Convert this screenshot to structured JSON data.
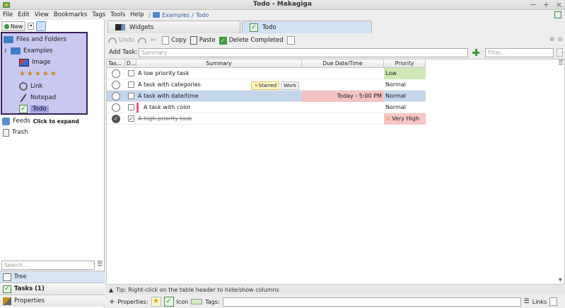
{
  "window": {
    "title": "Todo - Makagiga",
    "controls": [
      "−",
      "+",
      "×"
    ]
  },
  "menu": {
    "items": [
      "File",
      "Edit",
      "View",
      "Bookmarks",
      "Tags",
      "Tools",
      "Help"
    ],
    "breadcrumb": {
      "sep": "/",
      "items": [
        "Examples",
        "Todo"
      ]
    }
  },
  "left": {
    "new_label": "New",
    "tree": {
      "root": "Files and Folders",
      "folder": "Examples",
      "items": [
        "Image",
        "Link",
        "Notepad",
        "Todo"
      ],
      "rating_stars": "★★★★★",
      "expander": "↕"
    },
    "feeds": {
      "label": "Feeds",
      "hint": "Click to expand"
    },
    "trash": "Trash",
    "search_placeholder": "Search...",
    "accordion": [
      "Tree",
      "Tasks (1)",
      "Properties"
    ]
  },
  "tabs": [
    "Widgets",
    "Todo"
  ],
  "toolbar": {
    "undo": "Undo",
    "copy": "Copy",
    "paste": "Paste",
    "delete_completed": "Delete Completed"
  },
  "add_task": {
    "label": "Add Task:",
    "placeholder": "Summary",
    "filter_placeholder": "Filter..."
  },
  "table": {
    "headers": [
      "Tas...",
      "D...",
      "Summary",
      "Due Date/Time",
      "Priority"
    ],
    "rows": [
      {
        "summary": "A low priority task",
        "tags": [],
        "due": "",
        "priority": "Low",
        "done": false,
        "checked": false
      },
      {
        "summary": "A task with categories",
        "tags": [
          "Starred",
          "Work"
        ],
        "due": "",
        "priority": "Normal",
        "done": false,
        "checked": false
      },
      {
        "summary": "A task with date/time",
        "tags": [],
        "due": "Today - 5:00 PM",
        "priority": "Normal",
        "done": false,
        "checked": false
      },
      {
        "summary": "A task with color",
        "tags": [],
        "due": "",
        "priority": "Normal",
        "done": false,
        "checked": false
      },
      {
        "summary": "A high priority task",
        "tags": [],
        "due": "",
        "priority": "Very High",
        "done": true,
        "checked": true
      }
    ]
  },
  "tip": "Tip: Right-click on the table header to hide/show columns",
  "properties_bar": {
    "label": "Properties:",
    "icon_label": "Icon",
    "tags_label": "Tags:",
    "links_label": "Links"
  },
  "colors": {
    "selection": "#c5d6ec",
    "tree_highlight": "#c8c8f2",
    "low_priority": "#cfe8b4",
    "very_high_priority": "#f8c6c6",
    "due_today": "#f3c2c2"
  }
}
